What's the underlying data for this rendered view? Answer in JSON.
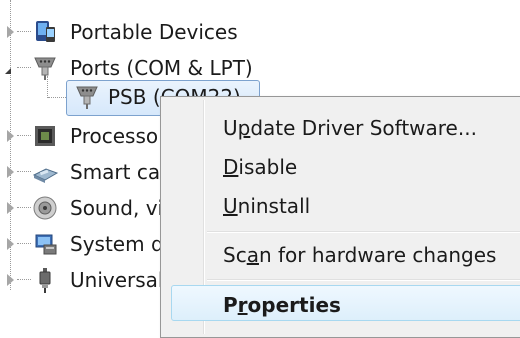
{
  "tree": {
    "items": [
      {
        "label": "Portable Devices",
        "icon": "portable-devices-icon",
        "expander": "collapsed"
      },
      {
        "label": "Ports (COM & LPT)",
        "icon": "port-connector-icon",
        "expander": "expanded"
      },
      {
        "label": "PSB (COM22)",
        "icon": "port-connector-icon",
        "selected": true
      },
      {
        "label": "Processo",
        "icon": "processor-chip-icon",
        "expander": "collapsed"
      },
      {
        "label": "Smart ca",
        "icon": "smart-card-reader-icon",
        "expander": "collapsed"
      },
      {
        "label": "Sound, vi",
        "icon": "speaker-icon",
        "expander": "collapsed"
      },
      {
        "label": "System d",
        "icon": "system-device-icon",
        "expander": "collapsed"
      },
      {
        "label": "Universal",
        "icon": "usb-plug-icon",
        "expander": "collapsed"
      }
    ]
  },
  "context_menu": {
    "items": [
      {
        "pre": "U",
        "key": "p",
        "post": "date Driver Software..."
      },
      {
        "pre": "",
        "key": "D",
        "post": "isable"
      },
      {
        "pre": "",
        "key": "U",
        "post": "ninstall"
      },
      {
        "pre": "Sc",
        "key": "a",
        "post": "n for hardware changes"
      },
      {
        "pre": "P",
        "key": "r",
        "post": "operties",
        "bold": true,
        "highlighted": true
      }
    ]
  },
  "colors": {
    "selection_border": "#7da2ce",
    "menu_background": "#f0f0f0",
    "hover_border": "#a8d8f0"
  }
}
